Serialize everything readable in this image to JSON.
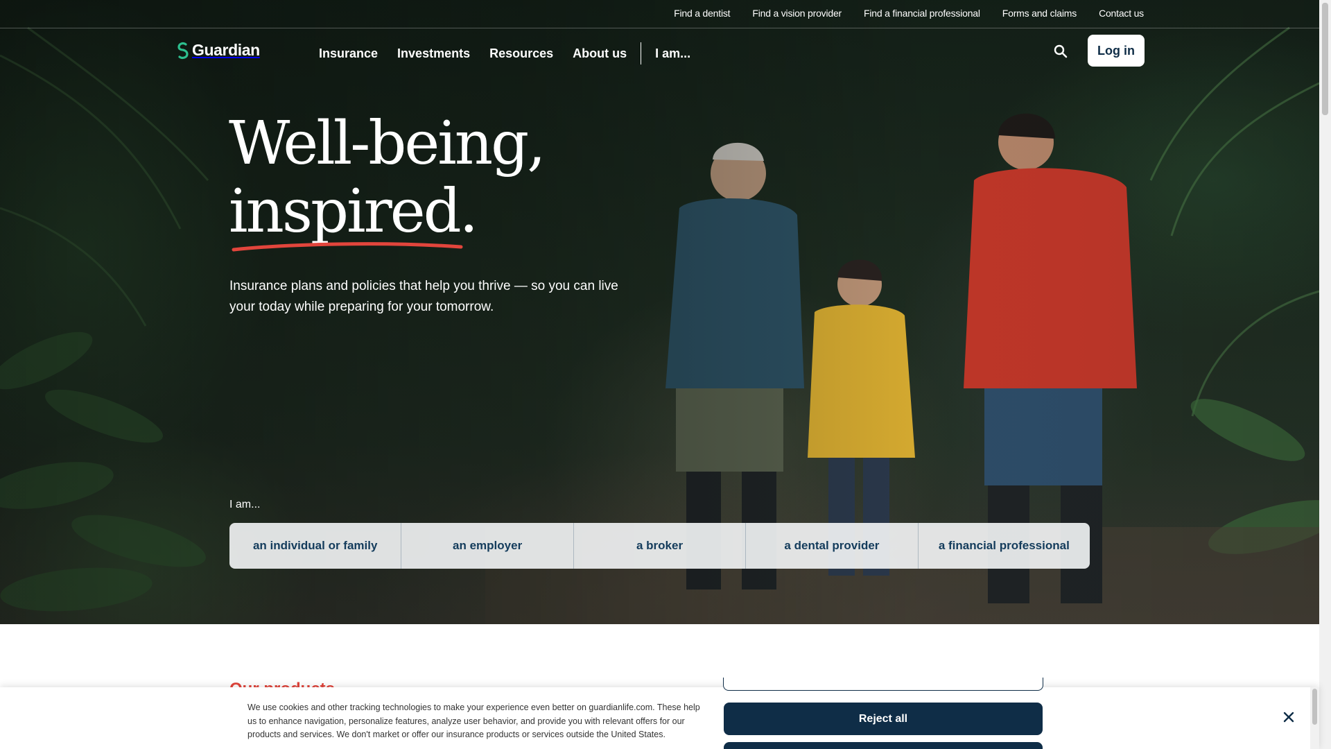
{
  "utility_nav": {
    "links": [
      "Find a dentist",
      "Find a vision provider",
      "Find a financial professional",
      "Forms and claims",
      "Contact us"
    ]
  },
  "header": {
    "logo_text": "Guardian",
    "nav": [
      "Insurance",
      "Investments",
      "Resources",
      "About us"
    ],
    "iam_menu": "I am...",
    "search_icon": "search-icon",
    "login_label": "Log in"
  },
  "hero": {
    "headline_line1": "Well-being,",
    "headline_line2": "inspired.",
    "subtitle": "Insurance plans and policies that help you thrive — so you can live your today while preparing for your tomorrow.",
    "iam_label": "I am...",
    "iam_options": [
      "an individual or family",
      "an employer",
      "a broker",
      "a dental provider",
      "a financial professional"
    ]
  },
  "section": {
    "heading_peek": "Our products"
  },
  "cookie_banner": {
    "text": "We use cookies and other tracking technologies to make your experience even better on guardianlife.com. These help us to enhance navigation, personalize features, analyze user behavior, and provide you with relevant offers for our products and services. We don't market or offer our insurance products or services outside the United States.",
    "reject_label": "Reject all",
    "close_icon": "close-icon"
  },
  "colors": {
    "navy": "#0f2d47",
    "accent_red": "#e2453c",
    "logo_green": "#2dbf8e"
  }
}
